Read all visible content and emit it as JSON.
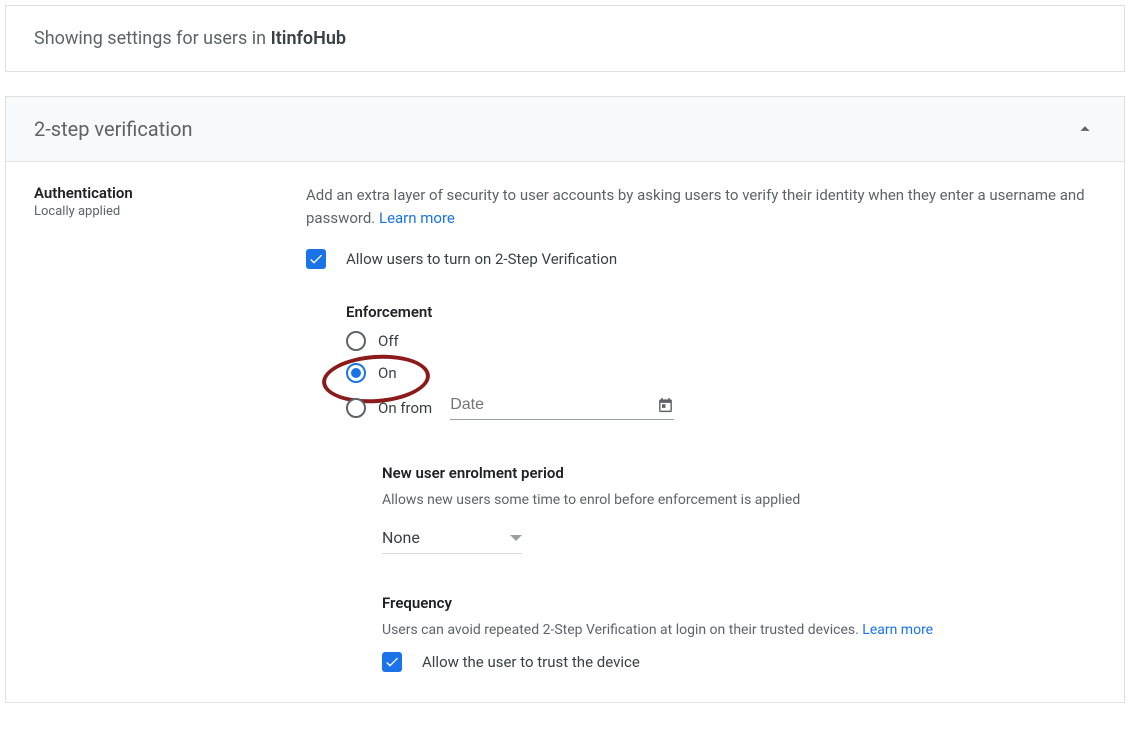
{
  "topbar": {
    "prefix": "Showing settings for users in ",
    "org_name": "ItinfoHub"
  },
  "section": {
    "title": "2-step verification",
    "left": {
      "title": "Authentication",
      "subtitle": "Locally applied"
    },
    "desc": {
      "text": "Add an extra layer of security to user accounts by asking users to verify their identity when they enter a username and password. ",
      "learn_more": "Learn more"
    },
    "allow_checkbox_label": "Allow users to turn on 2-Step Verification",
    "enforcement": {
      "title": "Enforcement",
      "options": {
        "off": "Off",
        "on": "On",
        "on_from": "On from"
      },
      "date_placeholder": "Date"
    },
    "enrolment": {
      "title": "New user enrolment period",
      "subtitle": "Allows new users some time to enrol before enforcement is applied",
      "selected": "None"
    },
    "frequency": {
      "title": "Frequency",
      "subtitle_text": "Users can avoid repeated 2-Step Verification at login on their trusted devices. ",
      "learn_more": "Learn more",
      "checkbox_label": "Allow the user to trust the device"
    }
  }
}
